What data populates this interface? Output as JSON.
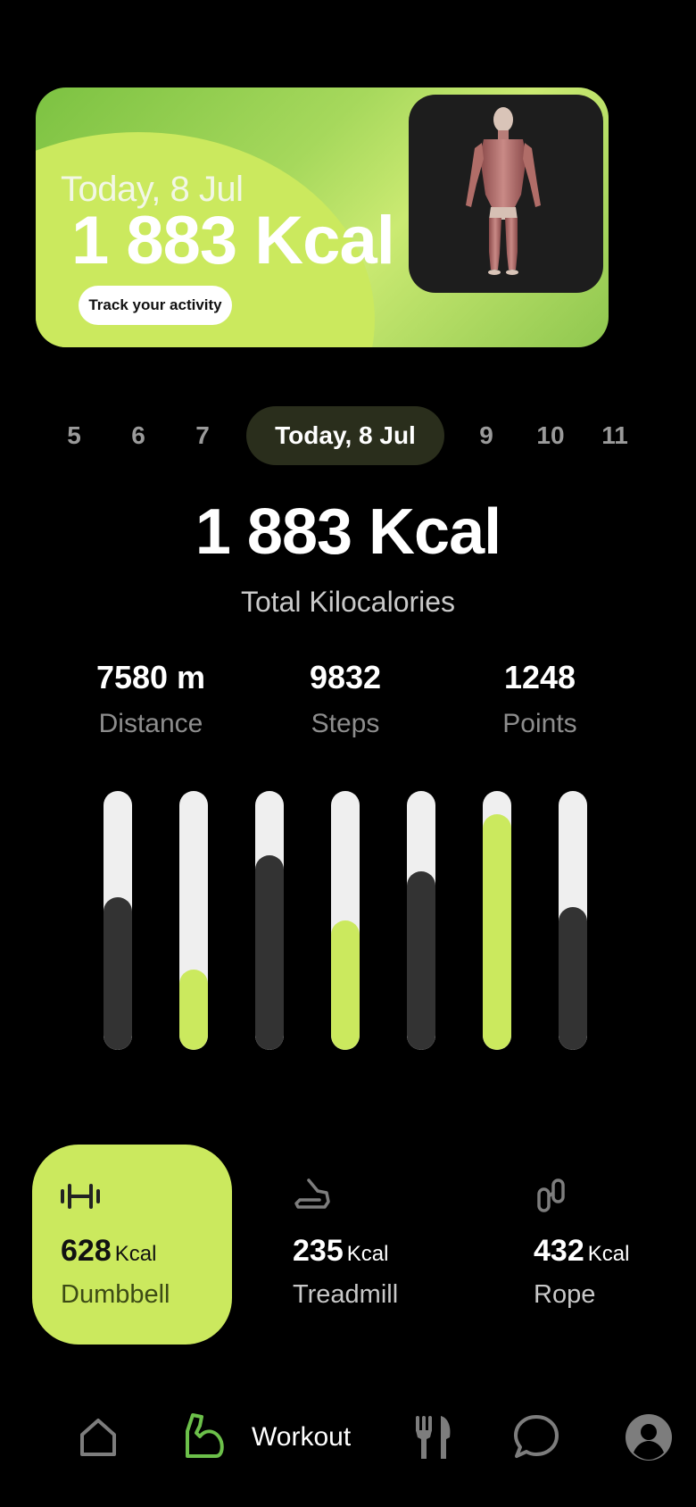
{
  "hero": {
    "date_label": "Today, 8 Jul",
    "kcal": "1 883 Kcal",
    "track_button": "Track your activity"
  },
  "date_selector": {
    "days": [
      "5",
      "6",
      "7",
      "Today, 8 Jul",
      "9",
      "10",
      "11"
    ],
    "active_index": 3
  },
  "summary": {
    "total_kcal": "1 883 Kcal",
    "total_label": "Total Kilocalories",
    "stats": [
      {
        "value": "7580 m",
        "label": "Distance"
      },
      {
        "value": "9832",
        "label": "Steps"
      },
      {
        "value": "1248",
        "label": "Points"
      }
    ]
  },
  "bars": {
    "levels": [
      0.59,
      0.31,
      0.75,
      0.5,
      0.69,
      0.91,
      0.55
    ],
    "highlighted": [
      false,
      true,
      false,
      true,
      false,
      true,
      false
    ],
    "colors": {
      "track": "#efefef",
      "dark": "#333333",
      "accent": "#cbe95e"
    }
  },
  "activities": [
    {
      "value": "628",
      "unit": "Kcal",
      "name": "Dumbbell",
      "icon": "dumbbell-icon",
      "selected": true
    },
    {
      "value": "235",
      "unit": "Kcal",
      "name": "Treadmill",
      "icon": "treadmill-icon",
      "selected": false
    },
    {
      "value": "432",
      "unit": "Kcal",
      "name": "Rope",
      "icon": "rope-icon",
      "selected": false
    }
  ],
  "nav": {
    "items": [
      "home-icon",
      "workout-icon",
      "food-icon",
      "chat-icon",
      "profile-icon"
    ],
    "active_label": "Workout"
  },
  "colors": {
    "accent": "#cbe95e",
    "background": "#000000"
  }
}
